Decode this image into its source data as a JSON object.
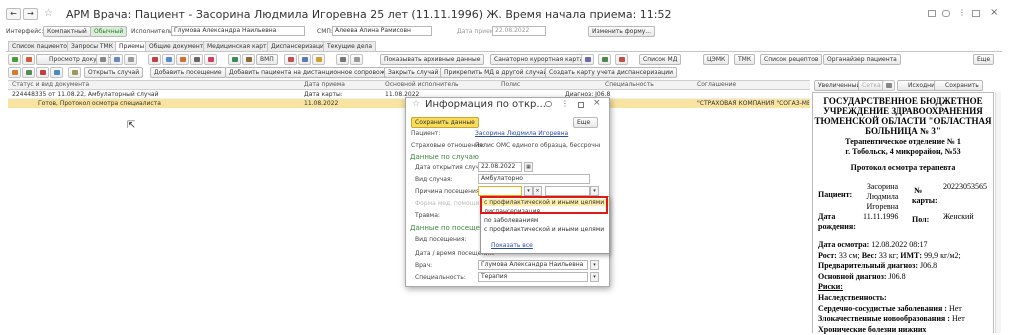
{
  "window": {
    "title": "АРМ Врача: Пациент - Засорина Людмила Игоревна 25 лет  (11.11.1996) Ж. Время начала приема: 11:52",
    "star": "☆"
  },
  "topbar": {
    "interface_label": "Интерфейс:",
    "compact": "Компактный",
    "normal": "Обычный",
    "executors_label": "Исполнители:",
    "executor_value": "Глумова Александра Наильевна",
    "smp_label": "СМП:",
    "smp_value": "Алеева Алина Рамисовн",
    "date_label": "Дата приема:",
    "date_value": "22.08.2022",
    "change_form": "Изменить форму..."
  },
  "tabs": [
    "Список пациентов",
    "Запросы ТМК",
    "Приемы",
    "Общие документы",
    "Медицинская карта",
    "Диспансеризация",
    "Текущие дела"
  ],
  "toolbar1": {
    "preview": "Просмотр документа",
    "vmp": "ВМП",
    "show_archive": "Показывать архивные данные",
    "sanatorium": "Санаторно курортная карта",
    "md_list": "Список МД",
    "cemk": "ЦЭМК",
    "tmk": "ТМК",
    "recipes": "Список рецептов",
    "organizer": "Органайзер пациента",
    "more": "Еще"
  },
  "toolbar2": {
    "open_case": "Открыть случай",
    "add_visit": "Добавить посещение",
    "add_remote": "Добавить пациента на дистанционное сопровождение",
    "close_case": "Закрыть случай",
    "attach_md": "Прикрепить МД в другой случай",
    "create_disp": "Создать карту учета диспансеризации"
  },
  "table": {
    "headers": [
      "Статус и вид документа",
      "Дата приема",
      "Основной исполнитель",
      "Полис",
      "Специальность",
      "Соглашение"
    ],
    "row1": {
      "status": "224448335 от 11.08.22, Амбулаторный случай",
      "date": "Дата карты:",
      "executor": "11.08.2022",
      "policy": "",
      "specialty": "Диагноз: J06.8",
      "agreement": ""
    },
    "row2": {
      "status": "Готов, Протокол осмотра специалиста",
      "date": "11.08.2022",
      "executor": "",
      "policy": "",
      "specialty": "",
      "agreement": "\"СТРАХОВАЯ КОМПАНИЯ \"СОГАЗ-МЕД\""
    }
  },
  "dialog": {
    "title": "Информация по откр...",
    "save": "Сохранить данные",
    "more": "Еще",
    "patient_label": "Пациент:",
    "patient_value": "Засорина Людмила Игоревна",
    "insurance_label": "Страховые отношения:",
    "insurance_value": "Полис ОМС единого образца, бесcрочный МI...",
    "case_section": "Данные по случаю",
    "open_date_label": "Дата открытия случая:",
    "open_date_value": "22.08.2022",
    "case_type_label": "Вид случая:",
    "case_type_value": "Амбулаторно",
    "reason_label": "Причина посещения:",
    "help_form_label": "Форма мед. помощи:",
    "trauma_label": "Травма:",
    "visit_section": "Данные по посещению",
    "visit_type_label": "Вид посещения:",
    "visit_date_label": "Дата / время посещения:",
    "doctor_label": "Врач:",
    "doctor_value": "Глумова Александра Наильевна",
    "specialty_label": "Специальность:",
    "specialty_value": "Терапия"
  },
  "dropdown": {
    "options": [
      "с профилактической и иными целями",
      "диспансеризация",
      "по заболеваниям",
      "с профилактической и иными целями"
    ],
    "show_all": "Показать все"
  },
  "preview": {
    "toolbar": {
      "enlarged": "Увеличенный",
      "grid": "Сетка",
      "source": "Исходник",
      "save": "Сохранить"
    },
    "header": [
      "ГОСУДАРСТВЕННОЕ БЮДЖЕТНОЕ",
      "УЧРЕЖДЕНИЕ ЗДРАВООХРАНЕНИЯ",
      "ТЮМЕНСКОЙ ОБЛАСТИ \"ОБЛАСТНАЯ",
      "БОЛЬНИЦА № 3\""
    ],
    "dept": "Терапевтическое отделение № 1",
    "address": "г. Тобольск, 4 микрорайон, №53",
    "protocol": "Протокол осмотра терапевта",
    "patient_label": "Пациент:",
    "patient_name": [
      "Засорина",
      "Людмила",
      "Игоревна"
    ],
    "card_label": [
      "№",
      "карты:"
    ],
    "card_no": "20223053565",
    "dob_label": [
      "Дата",
      "рождения:"
    ],
    "dob": "11.11.1996",
    "sex_label": "Пол:",
    "sex_value": [
      "Женский",
      ""
    ],
    "lines": [
      {
        "b": "Дата осмотра:",
        "t": " 12.08.2022 08:17"
      },
      {
        "b": "Рост:",
        "t": " 33 см; ",
        "b2": "Вес:",
        "t2": " 33 кг; ",
        "b3": "ИМТ:",
        "t3": " 99,9 кг/м2;"
      },
      {
        "b": "Предварительный диагноз:",
        "t": " J06.8"
      },
      {
        "b": "Основной диагноз:",
        "t": " J06.8"
      },
      {
        "b": "Риски:",
        "t": "",
        "u": true
      },
      {
        "b": "Наследственность:",
        "t": ""
      },
      {
        "b": "Сердечно-сосудистые заболевания :",
        "t": " Нет"
      },
      {
        "b": "Злокачественные новообразования :",
        "t": " Нет"
      },
      {
        "b": "Хронические болезни нижних",
        "t": ""
      }
    ]
  }
}
